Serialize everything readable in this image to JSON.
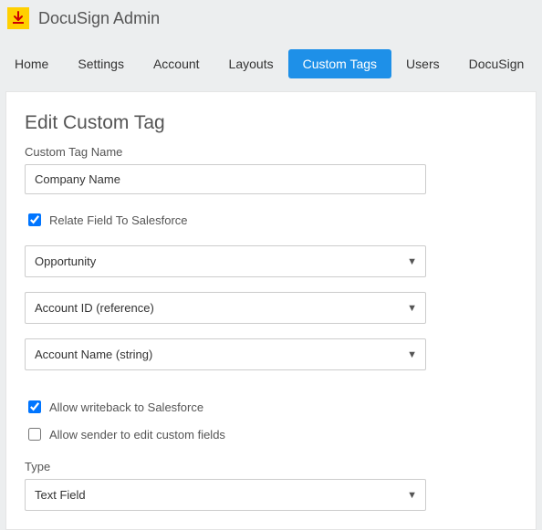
{
  "header": {
    "app_title": "DocuSign Admin"
  },
  "nav": {
    "items": [
      {
        "label": "Home",
        "active": false
      },
      {
        "label": "Settings",
        "active": false
      },
      {
        "label": "Account",
        "active": false
      },
      {
        "label": "Layouts",
        "active": false
      },
      {
        "label": "Custom Tags",
        "active": true
      },
      {
        "label": "Users",
        "active": false
      },
      {
        "label": "DocuSign",
        "active": false
      }
    ]
  },
  "form": {
    "page_title": "Edit Custom Tag",
    "name_label": "Custom Tag Name",
    "name_value": "Company Name",
    "relate_label": "Relate Field To Salesforce",
    "relate_checked": true,
    "object_value": "Opportunity",
    "field1_value": "Account ID (reference)",
    "field2_value": "Account Name (string)",
    "writeback_label": "Allow writeback to Salesforce",
    "writeback_checked": true,
    "edit_label": "Allow sender to edit custom fields",
    "edit_checked": false,
    "type_label": "Type",
    "type_value": "Text Field"
  }
}
